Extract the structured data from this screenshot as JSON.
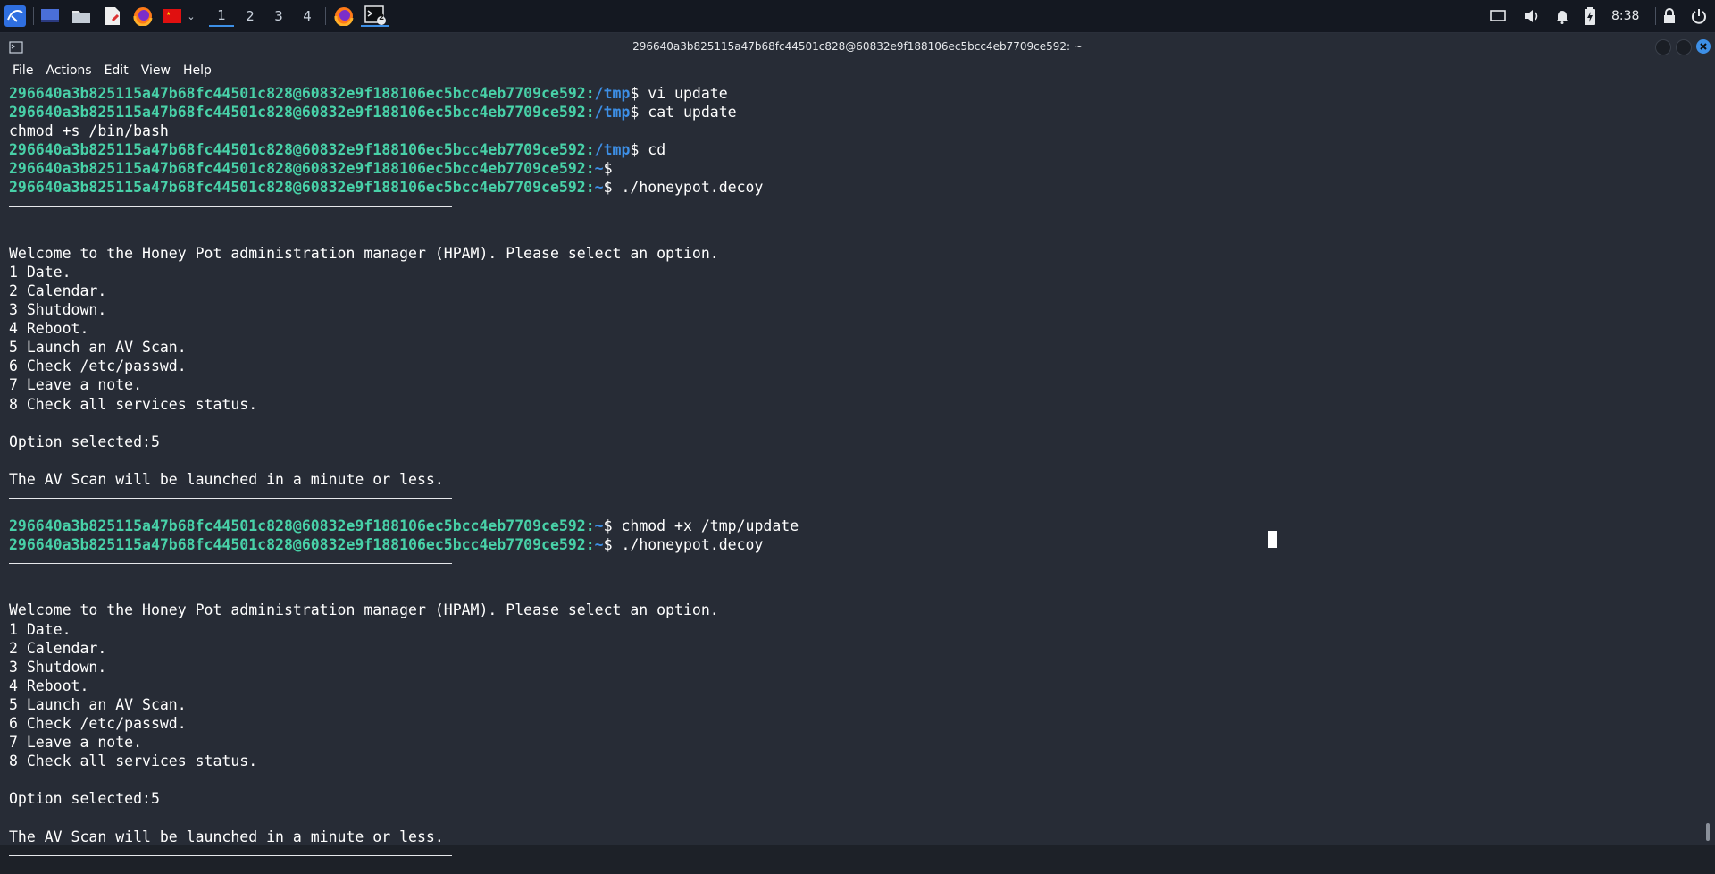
{
  "taskbar": {
    "workspaces": [
      "1",
      "2",
      "3",
      "4"
    ],
    "active_workspace": "1",
    "terminal_badge": "2",
    "clock": "8:38",
    "accent": "#3d8fe6"
  },
  "window": {
    "title": "296640a3b825115a47b68fc44501c828@60832e9f188106ec5bcc4eb7709ce592: ~"
  },
  "menu": [
    "File",
    "Actions",
    "Edit",
    "View",
    "Help"
  ],
  "prompt_user": "296640a3b825115a47b68fc44501c828@60832e9f188106ec5bcc4eb7709ce592",
  "terminal": [
    {
      "type": "prompt",
      "path": "/tmp",
      "cmd": "vi update"
    },
    {
      "type": "prompt",
      "path": "/tmp",
      "cmd": "cat update"
    },
    {
      "type": "out",
      "text": "chmod +s /bin/bash"
    },
    {
      "type": "prompt",
      "path": "/tmp",
      "cmd": "cd"
    },
    {
      "type": "prompt",
      "path": "~",
      "cmd": ""
    },
    {
      "type": "prompt",
      "path": "~",
      "cmd": "./honeypot.decoy"
    },
    {
      "type": "rule"
    },
    {
      "type": "out",
      "text": ""
    },
    {
      "type": "out",
      "text": "Welcome to the Honey Pot administration manager (HPAM). Please select an option."
    },
    {
      "type": "out",
      "text": "1 Date."
    },
    {
      "type": "out",
      "text": "2 Calendar."
    },
    {
      "type": "out",
      "text": "3 Shutdown."
    },
    {
      "type": "out",
      "text": "4 Reboot."
    },
    {
      "type": "out",
      "text": "5 Launch an AV Scan."
    },
    {
      "type": "out",
      "text": "6 Check /etc/passwd."
    },
    {
      "type": "out",
      "text": "7 Leave a note."
    },
    {
      "type": "out",
      "text": "8 Check all services status."
    },
    {
      "type": "out",
      "text": ""
    },
    {
      "type": "out",
      "text": "Option selected:5"
    },
    {
      "type": "out",
      "text": ""
    },
    {
      "type": "out",
      "text": "The AV Scan will be launched in a minute or less."
    },
    {
      "type": "rule"
    },
    {
      "type": "prompt",
      "path": "~",
      "cmd": "chmod +x /tmp/update"
    },
    {
      "type": "prompt",
      "path": "~",
      "cmd": "./honeypot.decoy"
    },
    {
      "type": "rule"
    },
    {
      "type": "out",
      "text": ""
    },
    {
      "type": "out",
      "text": "Welcome to the Honey Pot administration manager (HPAM). Please select an option."
    },
    {
      "type": "out",
      "text": "1 Date."
    },
    {
      "type": "out",
      "text": "2 Calendar."
    },
    {
      "type": "out",
      "text": "3 Shutdown."
    },
    {
      "type": "out",
      "text": "4 Reboot."
    },
    {
      "type": "out",
      "text": "5 Launch an AV Scan."
    },
    {
      "type": "out",
      "text": "6 Check /etc/passwd."
    },
    {
      "type": "out",
      "text": "7 Leave a note."
    },
    {
      "type": "out",
      "text": "8 Check all services status."
    },
    {
      "type": "out",
      "text": ""
    },
    {
      "type": "out",
      "text": "Option selected:5"
    },
    {
      "type": "out",
      "text": ""
    },
    {
      "type": "out",
      "text": "The AV Scan will be launched in a minute or less."
    },
    {
      "type": "rule"
    }
  ]
}
